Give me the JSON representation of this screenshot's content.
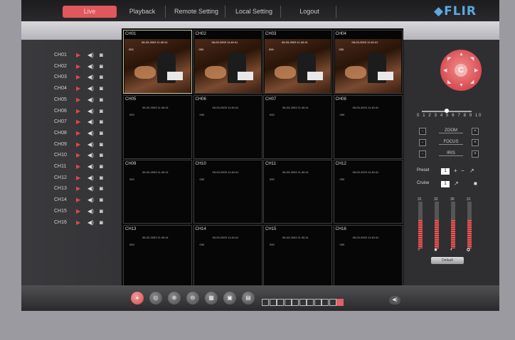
{
  "nav": {
    "tabs": [
      {
        "label": "Live",
        "active": true
      },
      {
        "label": "Playback",
        "active": false
      },
      {
        "label": "Remote Setting",
        "active": false
      },
      {
        "label": "Local Setting",
        "active": false
      },
      {
        "label": "Logout",
        "active": false
      }
    ],
    "logo_text": "FLIR"
  },
  "channels": [
    "CH01",
    "CH02",
    "CH03",
    "CH04",
    "CH05",
    "CH06",
    "CH07",
    "CH08",
    "CH09",
    "CH10",
    "CH11",
    "CH12",
    "CH13",
    "CH14",
    "CH15",
    "CH16"
  ],
  "grid": {
    "cells": [
      {
        "name": "CH01",
        "live": true,
        "timestamp": "06-03-2003 11:40:41",
        "tag": "000"
      },
      {
        "name": "CH02",
        "live": true,
        "timestamp": "06-03-2003 11:40:41",
        "tag": "000"
      },
      {
        "name": "CH03",
        "live": true,
        "timestamp": "06-03-2003 11:40:41",
        "tag": "000"
      },
      {
        "name": "CH04",
        "live": true,
        "timestamp": "06-03-2003 11:40:41",
        "tag": "000"
      },
      {
        "name": "CH05",
        "live": false,
        "timestamp": "06-03-2003 11:40:41",
        "tag": "000"
      },
      {
        "name": "CH06",
        "live": false,
        "timestamp": "06-03-2003 11:40:41",
        "tag": "000"
      },
      {
        "name": "CH07",
        "live": false,
        "timestamp": "06-03-2003 11:40:41",
        "tag": "000"
      },
      {
        "name": "CH08",
        "live": false,
        "timestamp": "06-03-2003 11:40:41",
        "tag": "000"
      },
      {
        "name": "CH09",
        "live": false,
        "timestamp": "06-03-2003 11:40:41",
        "tag": "000"
      },
      {
        "name": "CH10",
        "live": false,
        "timestamp": "06-03-2003 11:40:41",
        "tag": "000"
      },
      {
        "name": "CH11",
        "live": false,
        "timestamp": "06-03-2003 11:40:41",
        "tag": "000"
      },
      {
        "name": "CH12",
        "live": false,
        "timestamp": "06-03-2003 11:40:41",
        "tag": "000"
      },
      {
        "name": "CH13",
        "live": false,
        "timestamp": "06-03-2003 11:40:41",
        "tag": "000"
      },
      {
        "name": "CH14",
        "live": false,
        "timestamp": "06-03-2003 11:40:41",
        "tag": "000"
      },
      {
        "name": "CH15",
        "live": false,
        "timestamp": "06-03-2003 11:40:41",
        "tag": "000"
      },
      {
        "name": "CH16",
        "live": false,
        "timestamp": "06-03-2003 11:40:41",
        "tag": "000"
      }
    ],
    "selected": "CH01"
  },
  "ptz": {
    "center_label": "C",
    "speed_scale": "0 1 2 3 4 5 6 7 8 9 10",
    "speed_value": 6,
    "controls": [
      {
        "label": "ZOOM",
        "minus": "-",
        "plus": "+"
      },
      {
        "label": "FOCUS",
        "minus": "-",
        "plus": "+"
      },
      {
        "label": "IRIS",
        "minus": "-",
        "plus": "+"
      }
    ],
    "preset_label": "Preset",
    "preset_value": "1",
    "cruise_label": "Cruise",
    "cruise_value": "1"
  },
  "meters": [
    {
      "value": "31",
      "level": 0.6
    },
    {
      "value": "32",
      "level": 0.6
    },
    {
      "value": "30",
      "level": 0.6
    },
    {
      "value": "31",
      "level": 0.6
    }
  ],
  "default_button": "Default",
  "toolbar": {
    "layouts": 11,
    "active_layout": 10
  },
  "colors": {
    "accent": "#e0585c",
    "logo": "#5da9e0",
    "background": "#2d2d30"
  }
}
